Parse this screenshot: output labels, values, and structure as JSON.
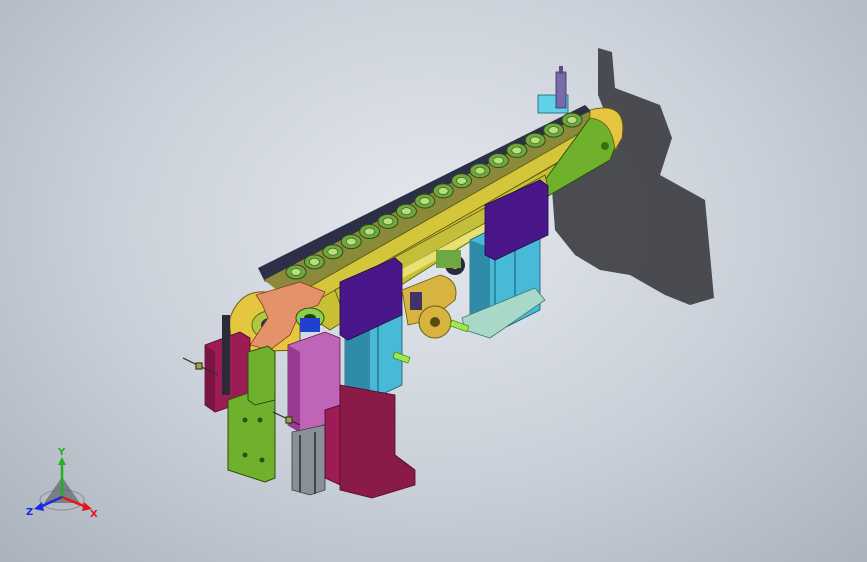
{
  "viewport": {
    "background_top": "#e4e8ee",
    "background_bottom": "#aab2bd"
  },
  "model": {
    "colors": {
      "belt_frame": "#c8c033",
      "belt_dark": "#2c2f45",
      "roller": "#6fa843",
      "cyl_blue": "#49b9d8",
      "purple": "#4a178a",
      "magenta": "#9d1c55",
      "green_plate": "#6fb12d",
      "gold": "#d7b340",
      "salmon": "#e3926a",
      "pink_block": "#c064b8",
      "shadow": "#3b3c40"
    },
    "roller_count": 16
  },
  "triad": {
    "x_label": "X",
    "y_label": "Y",
    "z_label": "Z",
    "x_color": "#e01818",
    "y_color": "#22b022",
    "z_color": "#1a2ae0"
  }
}
